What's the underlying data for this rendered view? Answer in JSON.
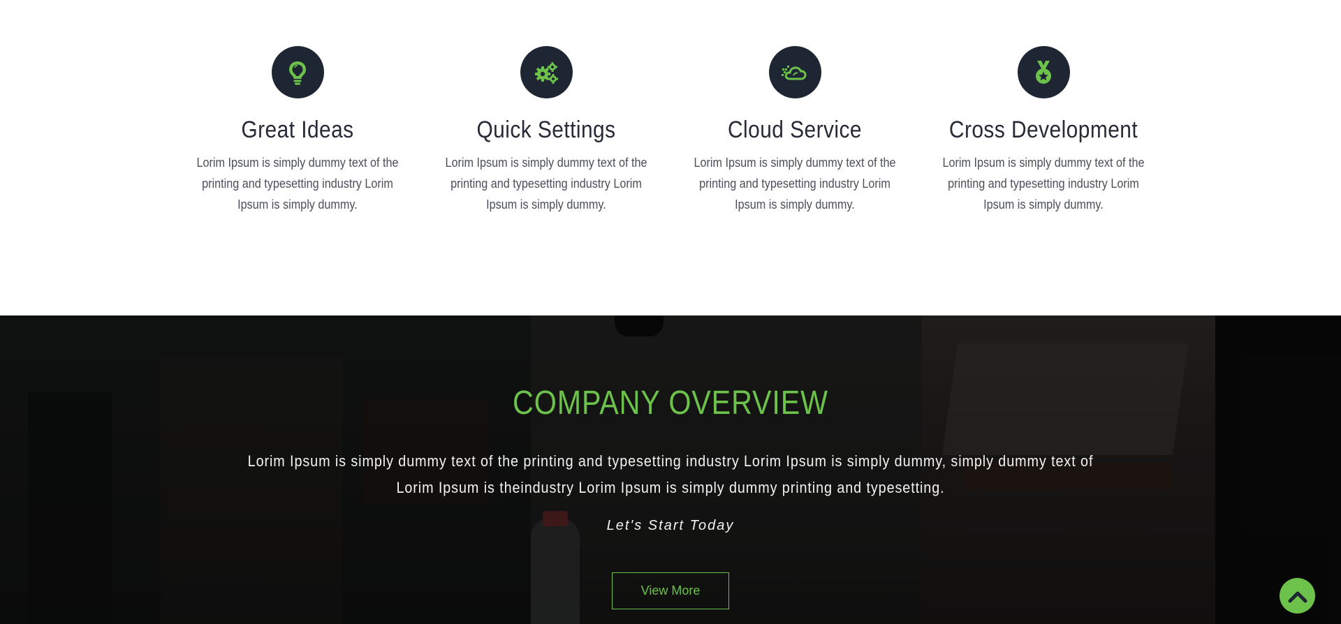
{
  "features": [
    {
      "icon": "lightbulb-icon",
      "title": "Great Ideas",
      "text": "Lorim Ipsum is simply dummy text of the printing and typesetting industry Lorim Ipsum is simply dummy."
    },
    {
      "icon": "gears-icon",
      "title": "Quick Settings",
      "text": "Lorim Ipsum is simply dummy text of the printing and typesetting industry Lorim Ipsum is simply dummy."
    },
    {
      "icon": "cloud-icon",
      "title": "Cloud Service",
      "text": "Lorim Ipsum is simply dummy text of the printing and typesetting industry Lorim Ipsum is simply dummy."
    },
    {
      "icon": "medal-icon",
      "title": "Cross Development",
      "text": "Lorim Ipsum is simply dummy text of the printing and typesetting industry Lorim Ipsum is simply dummy."
    }
  ],
  "overview": {
    "title": "COMPANY OVERVIEW",
    "text": "Lorim Ipsum is simply dummy text of the printing and typesetting industry Lorim Ipsum is simply dummy, simply dummy text of Lorim Ipsum is theindustry Lorim Ipsum is simply dummy printing and typesetting.",
    "tagline": "Let's Start Today",
    "button_label": "View More"
  },
  "scroll_top": {
    "icon": "chevron-up-icon"
  },
  "colors": {
    "accent": "#6cc24a",
    "icon_circle": "#1f2633",
    "heading": "#262b36",
    "body_text": "#4a4f59",
    "overview_bg": "#151617"
  }
}
